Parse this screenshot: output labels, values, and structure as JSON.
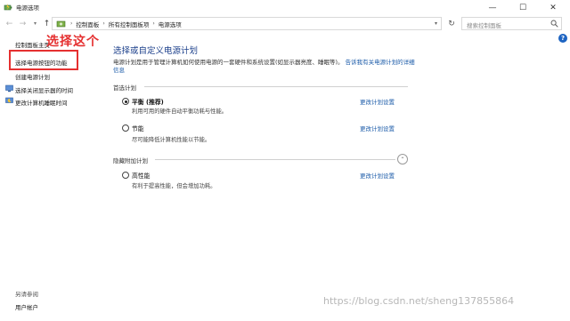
{
  "window": {
    "title": "电源选项",
    "minimize_glyph": "—",
    "maximize_glyph": "☐",
    "close_glyph": "✕"
  },
  "nav": {
    "back_glyph": "←",
    "forward_glyph": "→",
    "dropdown_glyph": "▾",
    "up_glyph": "↑",
    "breadcrumbs": [
      "控制面板",
      "所有控制面板项",
      "电源选项"
    ],
    "separator": "›",
    "refresh_glyph": "↻",
    "search_placeholder": "搜索控制面板"
  },
  "sidebar": {
    "items": [
      {
        "label": "控制面板主页"
      },
      {
        "label": "选择电源按钮的功能"
      },
      {
        "label": "创建电源计划"
      },
      {
        "label": "选择关闭显示器的时间"
      },
      {
        "label": "更改计算机睡眠时间"
      }
    ],
    "see_also": "另请参阅",
    "user_accounts": "用户帐户"
  },
  "annotation": {
    "text": "选择这个",
    "color": "#e53030"
  },
  "help_glyph": "?",
  "main": {
    "title": "选择或自定义电源计划",
    "intro_text": "电源计划是用于管理计算机如何使用电源的一套硬件和系统设置(如显示器亮度、睡眠等)。",
    "intro_link": "告诉我有关电源计划的详细信息",
    "preferred_group": "首选计划",
    "hidden_group": "隐藏附加计划",
    "collapse_glyph": "⌃",
    "plans": [
      {
        "name": "平衡 (推荐)",
        "desc": "利用可用的硬件自动平衡功耗与性能。",
        "link": "更改计划设置",
        "selected": true
      },
      {
        "name": "节能",
        "desc": "尽可能降低计算机性能以节能。",
        "link": "更改计划设置",
        "selected": false
      },
      {
        "name": "高性能",
        "desc": "有利于提高性能，但会增加功耗。",
        "link": "更改计划设置",
        "selected": false
      }
    ]
  },
  "watermark": "https://blog.csdn.net/sheng137855864",
  "colors": {
    "link": "#1a5aa8",
    "title": "#1a3e8a",
    "help": "#1d64c2"
  }
}
